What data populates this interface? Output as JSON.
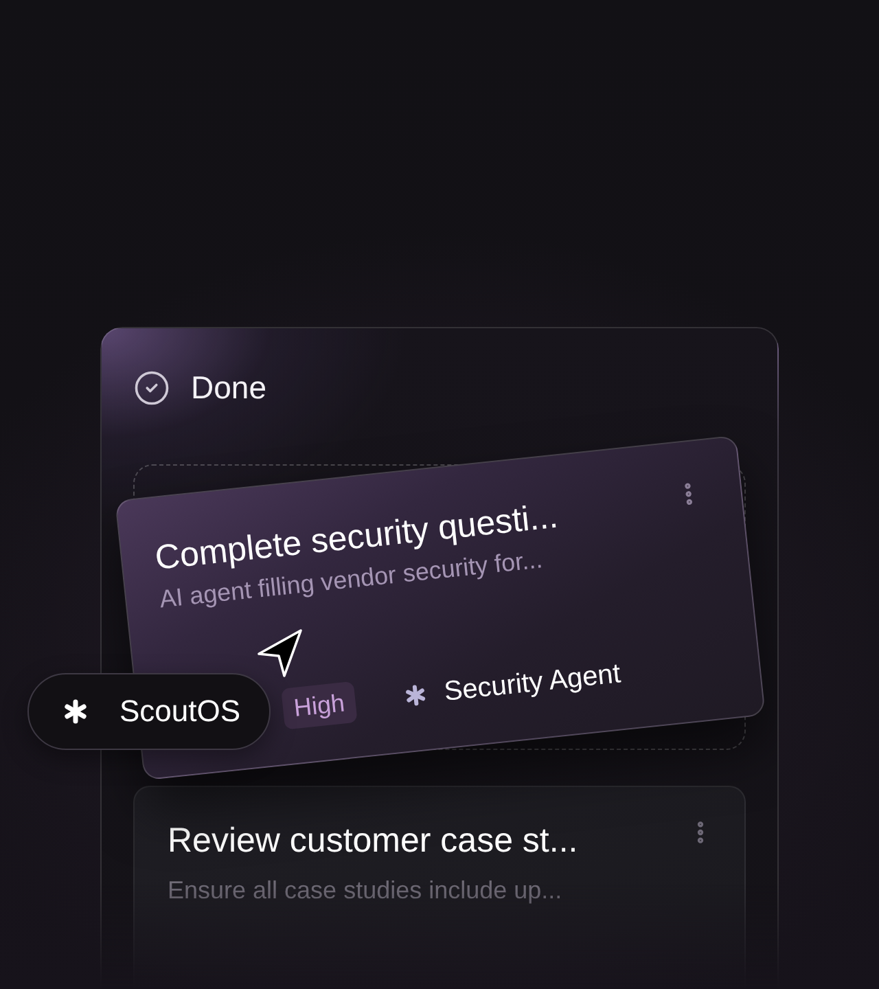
{
  "column": {
    "title": "Done",
    "cards": [
      {
        "title": "Complete security questi...",
        "description": "AI agent filling vendor security for...",
        "priority": "High",
        "assignee": "Security Agent",
        "dragging": true
      },
      {
        "title": "Review customer case st...",
        "description": "Ensure all case studies include up...",
        "dragging": false
      }
    ]
  },
  "cursor_tag": {
    "label": "ScoutOS"
  }
}
